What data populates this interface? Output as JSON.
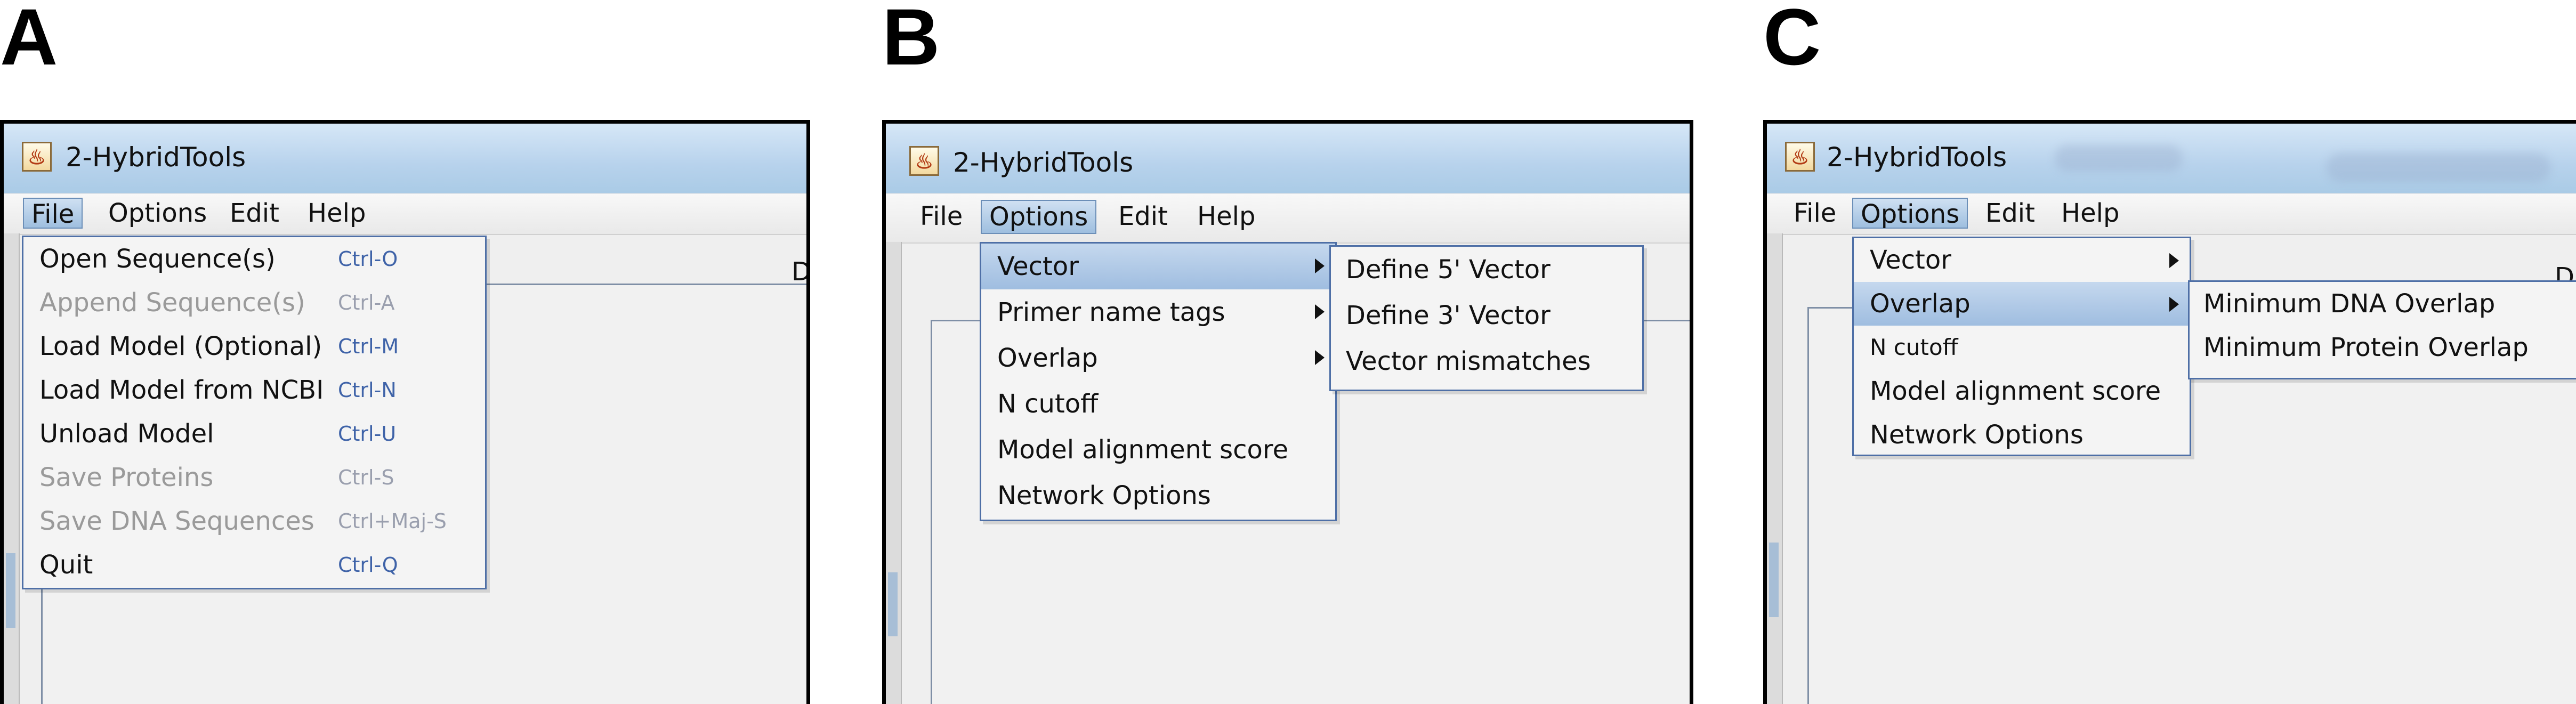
{
  "panels": [
    {
      "letter": "A",
      "window_title": "2-HybridTools",
      "menubar": [
        "File",
        "Options",
        "Edit",
        "Help"
      ],
      "active_menu": "File",
      "stray_text": "D",
      "file_menu": [
        {
          "label": "Open Sequence(s)",
          "shortcut": "Ctrl-O",
          "enabled": true
        },
        {
          "label": "Append Sequence(s)",
          "shortcut": "Ctrl-A",
          "enabled": false
        },
        {
          "label": "Load Model (Optional)",
          "shortcut": "Ctrl-M",
          "enabled": true
        },
        {
          "label": "Load Model from NCBI",
          "shortcut": "Ctrl-N",
          "enabled": true
        },
        {
          "label": "Unload Model",
          "shortcut": "Ctrl-U",
          "enabled": true
        },
        {
          "label": "Save Proteins",
          "shortcut": "Ctrl-S",
          "enabled": false
        },
        {
          "label": "Save DNA Sequences",
          "shortcut": "Ctrl+Maj-S",
          "enabled": false
        },
        {
          "label": "Quit",
          "shortcut": "Ctrl-Q",
          "enabled": true
        }
      ]
    },
    {
      "letter": "B",
      "window_title": "2-HybridTools",
      "menubar": [
        "File",
        "Options",
        "Edit",
        "Help"
      ],
      "active_menu": "Options",
      "options_menu": [
        "Vector",
        "Primer name tags",
        "Overlap",
        "N cutoff",
        "Model alignment score",
        "Network Options"
      ],
      "highlighted": "Vector",
      "vector_submenu": [
        "Define 5' Vector",
        "Define 3' Vector",
        "Vector mismatches"
      ]
    },
    {
      "letter": "C",
      "window_title": "2-HybridTools",
      "menubar": [
        "File",
        "Options",
        "Edit",
        "Help"
      ],
      "active_menu": "Options",
      "stray_text": "D",
      "options_menu": [
        "Vector",
        "Overlap",
        "N cutoff",
        "Model alignment score",
        "Network Options"
      ],
      "highlighted": "Overlap",
      "overlap_submenu": [
        "Minimum DNA Overlap",
        "Minimum Protein Overlap"
      ]
    }
  ]
}
